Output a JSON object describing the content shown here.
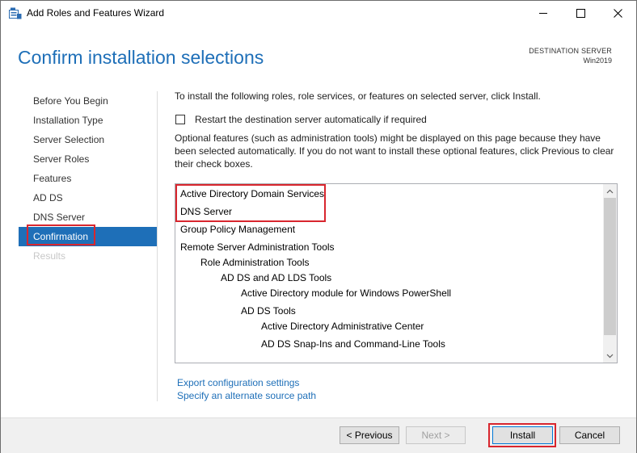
{
  "window": {
    "title": "Add Roles and Features Wizard"
  },
  "header": {
    "title": "Confirm installation selections",
    "destination_label": "DESTINATION SERVER",
    "destination_value": "Win2019"
  },
  "nav": {
    "items": [
      {
        "label": "Before You Begin",
        "state": "normal"
      },
      {
        "label": "Installation Type",
        "state": "normal"
      },
      {
        "label": "Server Selection",
        "state": "normal"
      },
      {
        "label": "Server Roles",
        "state": "normal"
      },
      {
        "label": "Features",
        "state": "normal"
      },
      {
        "label": "AD DS",
        "state": "normal"
      },
      {
        "label": "DNS Server",
        "state": "normal"
      },
      {
        "label": "Confirmation",
        "state": "active"
      },
      {
        "label": "Results",
        "state": "disabled"
      }
    ]
  },
  "main": {
    "intro": "To install the following roles, role services, or features on selected server, click Install.",
    "restart_label": "Restart the destination server automatically if required",
    "restart_checked": false,
    "optional_note": "Optional features (such as administration tools) might be displayed on this page because they have been selected automatically. If you do not want to install these optional features, click Previous to clear their check boxes.",
    "features": [
      {
        "label": "Active Directory Domain Services",
        "level": 0
      },
      {
        "label": "DNS Server",
        "level": 0
      },
      {
        "label": "Group Policy Management",
        "level": 0
      },
      {
        "label": "Remote Server Administration Tools",
        "level": 0
      },
      {
        "label": "Role Administration Tools",
        "level": 1
      },
      {
        "label": "AD DS and AD LDS Tools",
        "level": 2
      },
      {
        "label": "Active Directory module for Windows PowerShell",
        "level": 3
      },
      {
        "label": "AD DS Tools",
        "level": 3
      },
      {
        "label": "Active Directory Administrative Center",
        "level": 4
      },
      {
        "label": "AD DS Snap-Ins and Command-Line Tools",
        "level": 4
      }
    ],
    "links": {
      "export": "Export configuration settings",
      "alt_source": "Specify an alternate source path"
    }
  },
  "buttons": {
    "previous": "< Previous",
    "next": "Next >",
    "install": "Install",
    "cancel": "Cancel"
  },
  "colors": {
    "accent": "#1e6fb8",
    "highlight": "#d8262e"
  }
}
